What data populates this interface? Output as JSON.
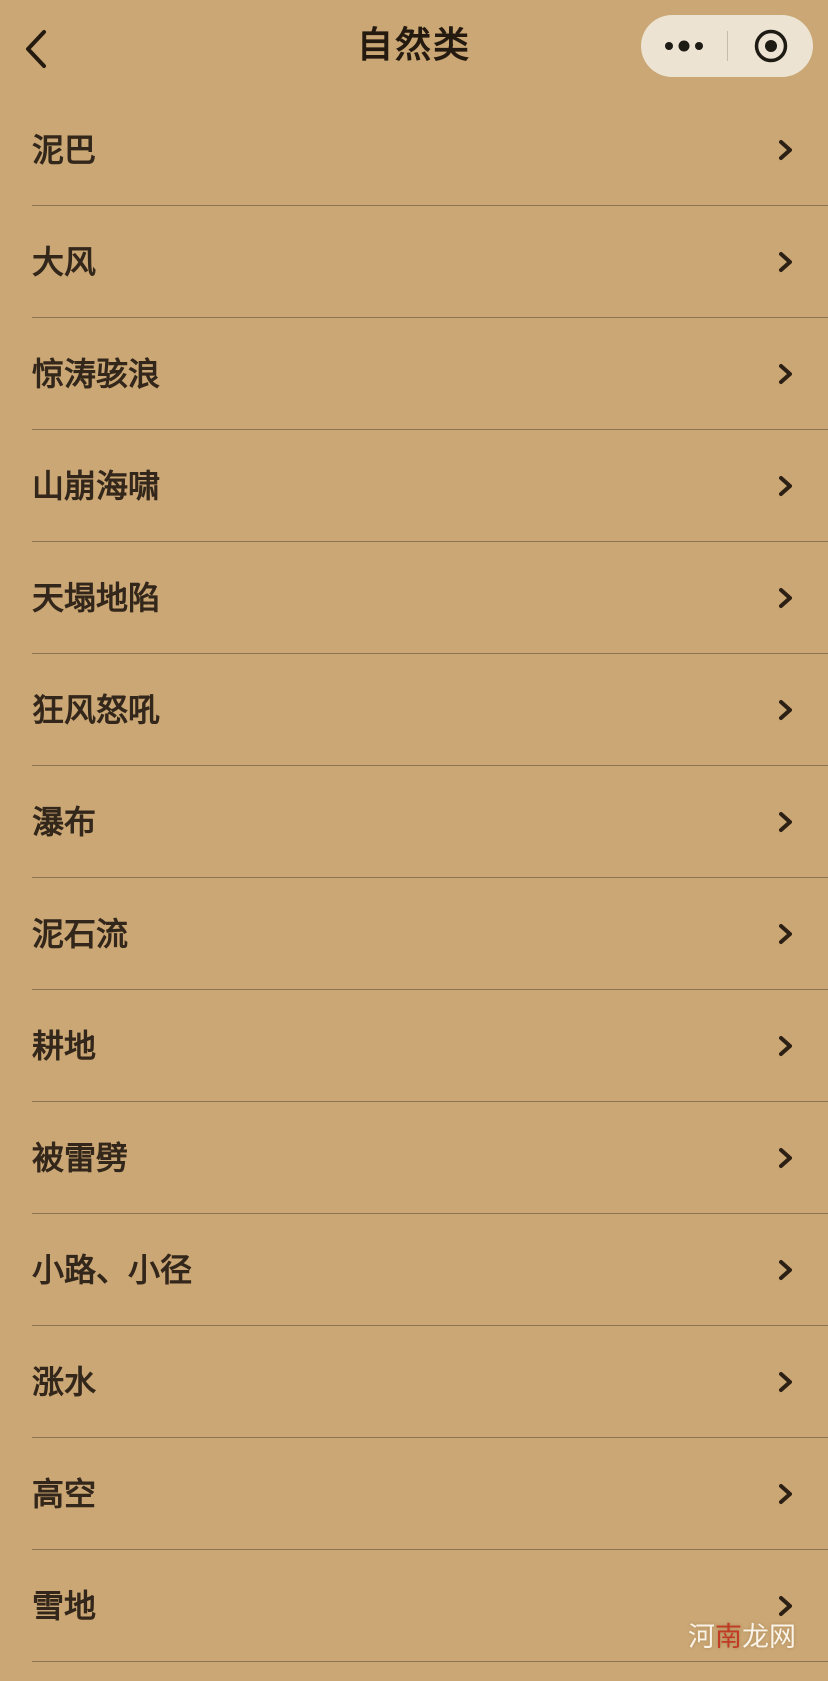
{
  "header": {
    "title": "自然类"
  },
  "icons": {
    "back": "chevron-left-icon",
    "more": "more-dots-icon",
    "close": "target-circle-icon",
    "row_arrow": "chevron-right-icon"
  },
  "colors": {
    "background": "#caa774",
    "text": "#33261a",
    "divider": "#8c7452",
    "capsule": "#ece3d2"
  },
  "list": {
    "items": [
      {
        "label": "泥巴"
      },
      {
        "label": "大风"
      },
      {
        "label": "惊涛骇浪"
      },
      {
        "label": "山崩海啸"
      },
      {
        "label": "天塌地陷"
      },
      {
        "label": "狂风怒吼"
      },
      {
        "label": "瀑布"
      },
      {
        "label": "泥石流"
      },
      {
        "label": "耕地"
      },
      {
        "label": "被雷劈"
      },
      {
        "label": "小路、小径"
      },
      {
        "label": "涨水"
      },
      {
        "label": "高空"
      },
      {
        "label": "雪地"
      }
    ]
  },
  "watermark": {
    "part1": "河",
    "part2": "南",
    "part3": "龙网"
  }
}
